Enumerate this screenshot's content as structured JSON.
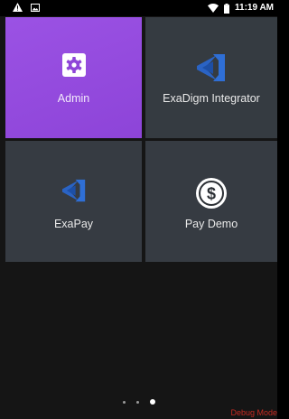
{
  "status_bar": {
    "time": "11:19 AM",
    "left_icons": [
      "warning-icon",
      "image-icon"
    ],
    "right_icons": [
      "wifi-icon",
      "battery-icon"
    ]
  },
  "apps": [
    {
      "label": "Admin",
      "icon": "gear-icon",
      "color": "#8e45d8"
    },
    {
      "label": "ExaDigm Integrator",
      "icon": "exadigm-logo-icon",
      "color": "#353b41"
    },
    {
      "label": "ExaPay",
      "icon": "exadigm-logo-icon",
      "color": "#363b42"
    },
    {
      "label": "Pay Demo",
      "icon": "dollar-coin-icon",
      "color": "#363b42"
    }
  ],
  "page_indicator": {
    "count": 3,
    "active_index": 2
  },
  "debug_label": "Debug Mode",
  "colors": {
    "admin_tile": "#8e45d8",
    "tile": "#363b42",
    "logo_blue": "#2f6fd6",
    "debug_red": "#c62a22"
  }
}
